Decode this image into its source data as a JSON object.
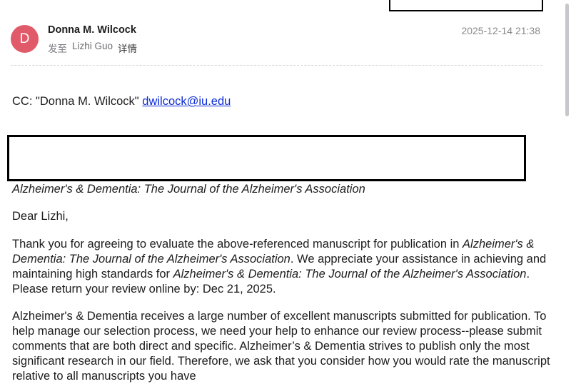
{
  "sender": {
    "avatar_letter": "D",
    "name": "Donna M. Wilcock",
    "to_prefix": "发至",
    "to_name": "Lizhi Guo",
    "details_label": "详情",
    "timestamp": "2025-12-14 21:38"
  },
  "cc": {
    "prefix": "CC: \"Donna M. Wilcock\"",
    "email": "dwilcock@iu.edu"
  },
  "journal_name": "Alzheimer's & Dementia: The Journal of the Alzheimer's Association",
  "greeting": "Dear Lizhi,",
  "paragraph1": {
    "part1": "Thank you for agreeing to evaluate the above-referenced manuscript for publication in ",
    "journal1": "Alzheimer's & Dementia: The Journal of the Alzheimer's Association",
    "part2": ". We appreciate your assistance in achieving and maintaining high standards for ",
    "journal2": "Alzheimer's & Dementia: The Journal of the Alzheimer's Association",
    "part3": ". Please return your review online by: Dec 21, 2025."
  },
  "paragraph2": "Alzheimer's & Dementia receives a large number of excellent manuscripts submitted for publication.   To help manage our selection process, we need your help to enhance our review process--please submit comments that are both direct and specific. Alzheimer’s & Dementia strives to publish only the most significant research in our field. Therefore, we ask that you consider how you would rate the manuscript relative to all manuscripts you have",
  "colors": {
    "avatar_bg": "#e05a69",
    "link": "#0b2bd6"
  }
}
